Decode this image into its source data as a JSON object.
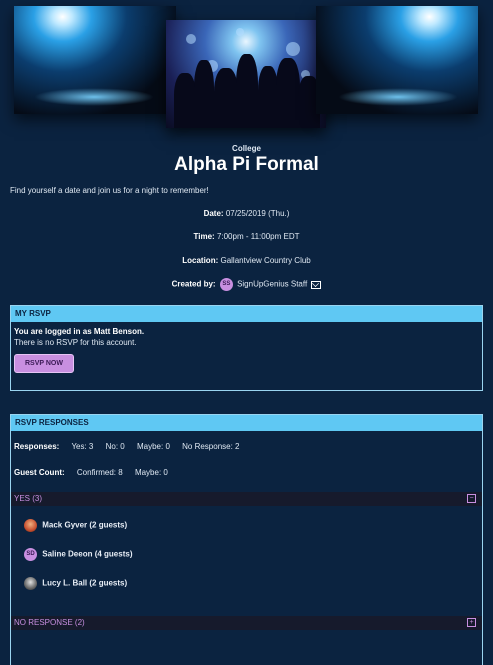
{
  "event": {
    "category": "College",
    "title": "Alpha Pi Formal",
    "description": "Find yourself a date and join us for a night to remember!",
    "date_label": "Date:",
    "date_value": "07/25/2019 (Thu.)",
    "time_label": "Time:",
    "time_value": "7:00pm - 11:00pm EDT",
    "location_label": "Location:",
    "location_value": "Gallantview Country Club",
    "created_label": "Created by:",
    "creator_initials": "SS",
    "creator_name": "SignUpGenius Staff"
  },
  "my_rsvp": {
    "header": "MY RSVP",
    "logged_in": "You are logged in as Matt Benson.",
    "no_rsvp": "There is no RSVP for this account.",
    "button": "RSVP NOW"
  },
  "responses": {
    "header": "RSVP RESPONSES",
    "responses_label": "Responses:",
    "yes": "Yes: 3",
    "no": "No: 0",
    "maybe": "Maybe: 0",
    "no_response": "No Response: 2",
    "guest_label": "Guest Count:",
    "confirmed": "Confirmed: 8",
    "guest_maybe": "Maybe: 0",
    "yes_group": "YES (3)",
    "yes_toggle": "−",
    "people": [
      {
        "name": "Mack Gyver (2 guests)",
        "initials": ""
      },
      {
        "name": "Saline Deeon (4 guests)",
        "initials": "SD"
      },
      {
        "name": "Lucy L. Ball (2 guests)",
        "initials": ""
      }
    ],
    "no_response_group": "NO RESPONSE (2)",
    "no_response_toggle": "+"
  },
  "colors": {
    "background": "#0b2340",
    "panel_header": "#5fc8f3",
    "accent_purple": "#c88fe0"
  }
}
